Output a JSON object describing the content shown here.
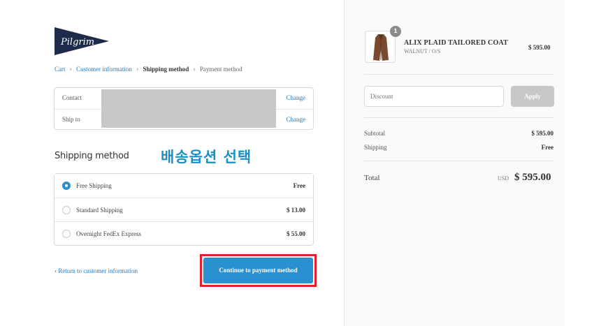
{
  "brand": {
    "logo_text": "Pilgrim"
  },
  "breadcrumb": {
    "items": [
      {
        "label": "Cart"
      },
      {
        "label": "Customer information"
      },
      {
        "label": "Shipping method"
      },
      {
        "label": "Payment method"
      }
    ]
  },
  "info": {
    "contact_label": "Contact",
    "ship_to_label": "Ship to",
    "change_label": "Change"
  },
  "shipping": {
    "title": "Shipping method",
    "annotation": "배송옵션 선택",
    "options": [
      {
        "label": "Free Shipping",
        "price": "Free",
        "selected": true
      },
      {
        "label": "Standard Shipping",
        "price": "$ 13.00",
        "selected": false
      },
      {
        "label": "Overnight FedEx Express",
        "price": "$ 55.00",
        "selected": false
      }
    ]
  },
  "actions": {
    "return_label": "‹ Return to customer information",
    "continue_label": "Continue to payment method"
  },
  "summary": {
    "product": {
      "quantity": "1",
      "name": "ALIX PLAID TAILORED COAT",
      "variant": "WALNUT / O/S",
      "price": "$ 595.00"
    },
    "discount": {
      "placeholder": "Discount",
      "apply_label": "Apply"
    },
    "subtotal_label": "Subtotal",
    "subtotal_value": "$ 595.00",
    "shipping_label": "Shipping",
    "shipping_value": "Free",
    "total_label": "Total",
    "currency": "USD",
    "total_value": "$ 595.00"
  },
  "colors": {
    "link": "#2a7ab8",
    "primary_button": "#2a90d0",
    "annotation": "#1a8fc8",
    "highlight_border": "#e0202a",
    "logo": "#1c2b4a"
  }
}
